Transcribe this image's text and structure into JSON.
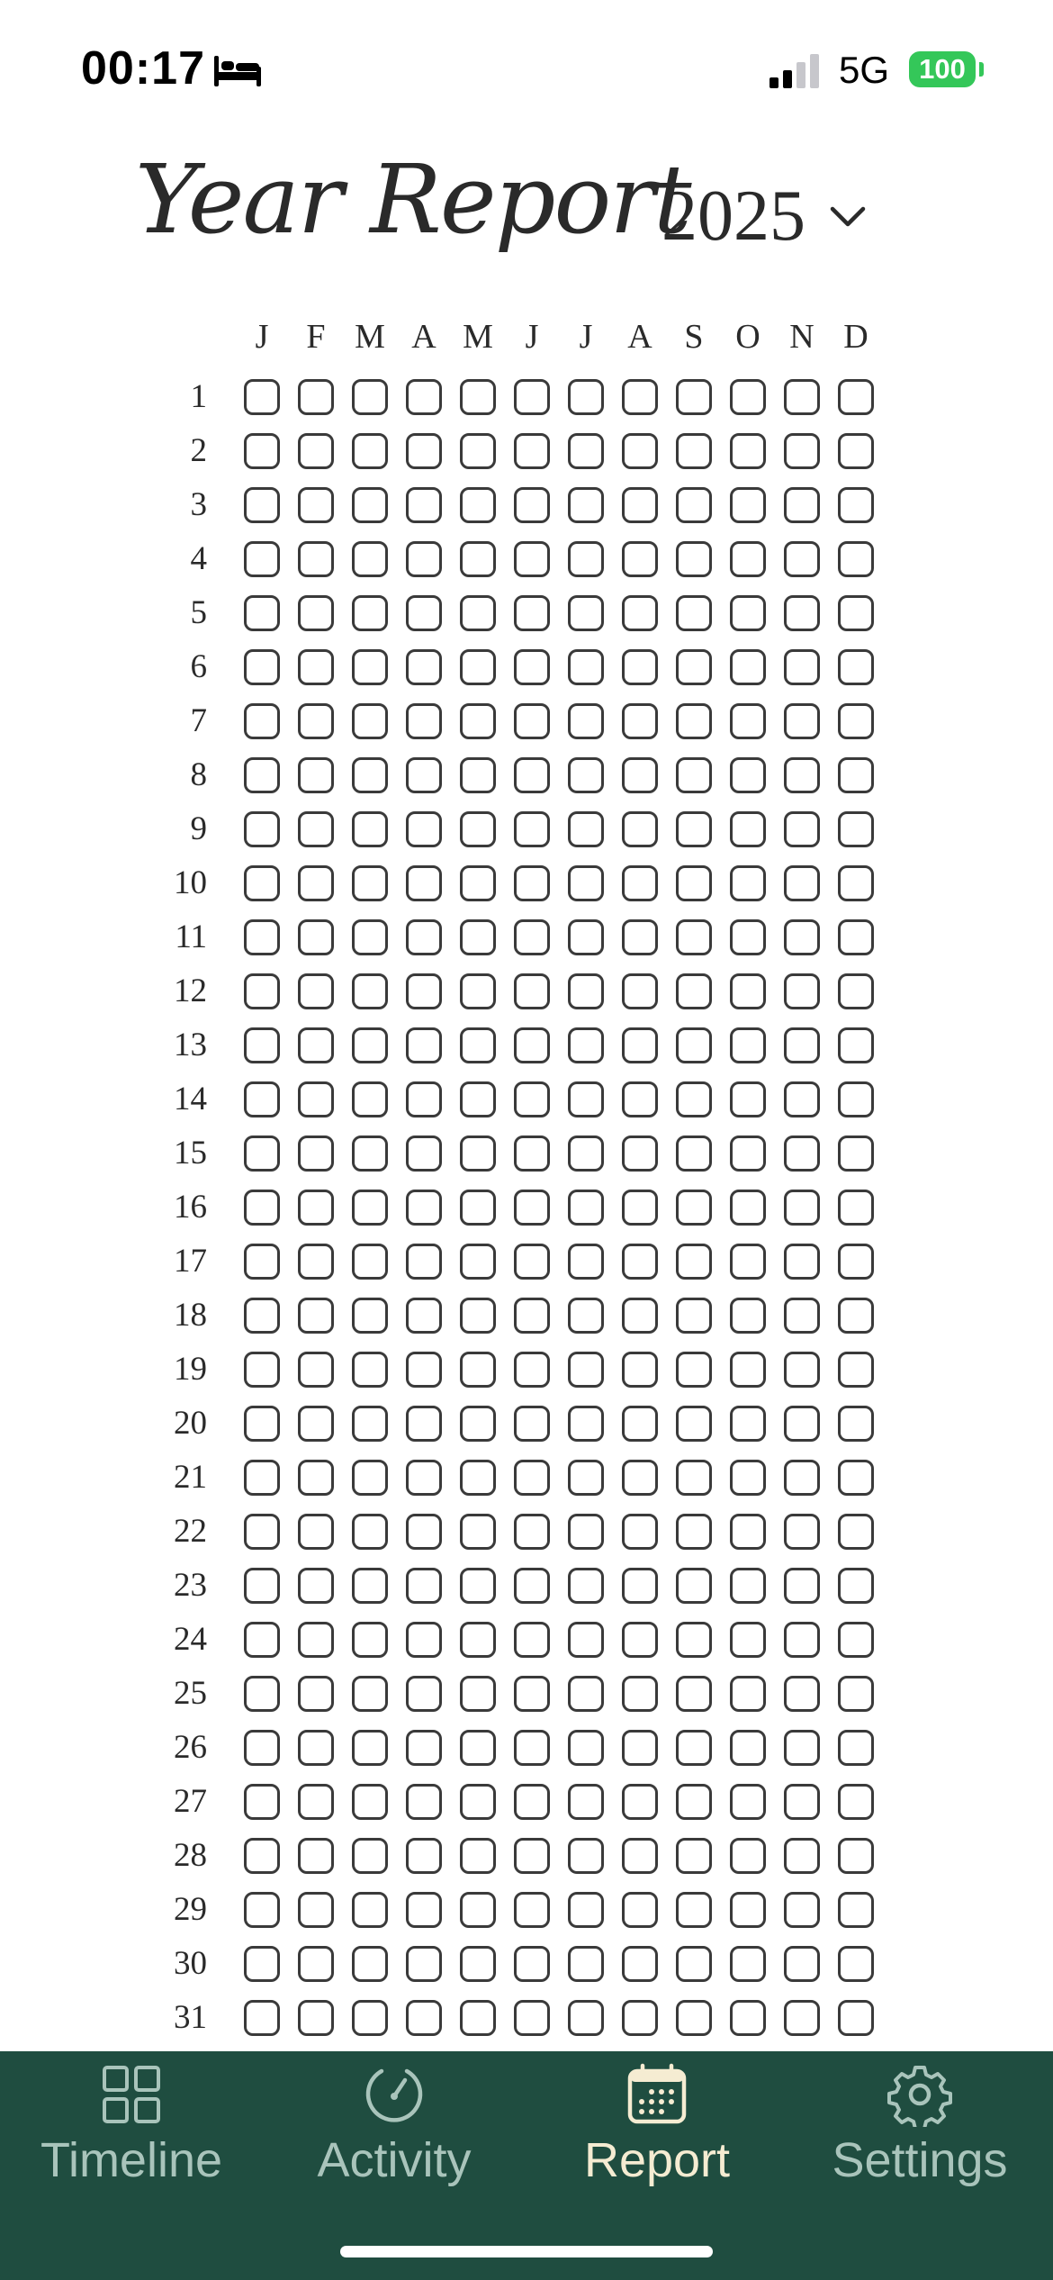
{
  "status_bar": {
    "time": "00:17",
    "network": "5G",
    "battery": "100",
    "icons": [
      "bed-icon",
      "signal-icon",
      "battery-icon"
    ]
  },
  "header": {
    "title": "Year Report",
    "year": "2025",
    "year_selector_icon": "chevron-down-icon"
  },
  "grid": {
    "months": [
      "J",
      "F",
      "M",
      "A",
      "M",
      "J",
      "J",
      "A",
      "S",
      "O",
      "N",
      "D"
    ],
    "days": [
      "1",
      "2",
      "3",
      "4",
      "5",
      "6",
      "7",
      "8",
      "9",
      "10",
      "11",
      "12",
      "13",
      "14",
      "15",
      "16",
      "17",
      "18",
      "19",
      "20",
      "21",
      "22",
      "23",
      "24",
      "25",
      "26",
      "27",
      "28",
      "29",
      "30",
      "31"
    ],
    "cells_filled": 0
  },
  "tab_bar": {
    "tabs": [
      {
        "label": "Timeline",
        "icon": "grid-icon",
        "active": false
      },
      {
        "label": "Activity",
        "icon": "gauge-icon",
        "active": false
      },
      {
        "label": "Report",
        "icon": "calendar-icon",
        "active": true
      },
      {
        "label": "Settings",
        "icon": "gear-icon",
        "active": false
      }
    ]
  },
  "colors": {
    "tab_bar_bg": "#1f4d40",
    "tab_inactive": "#a9c4bb",
    "tab_active": "#f5ecd2",
    "battery": "#34c759",
    "cell_border": "#3a3a3a"
  }
}
